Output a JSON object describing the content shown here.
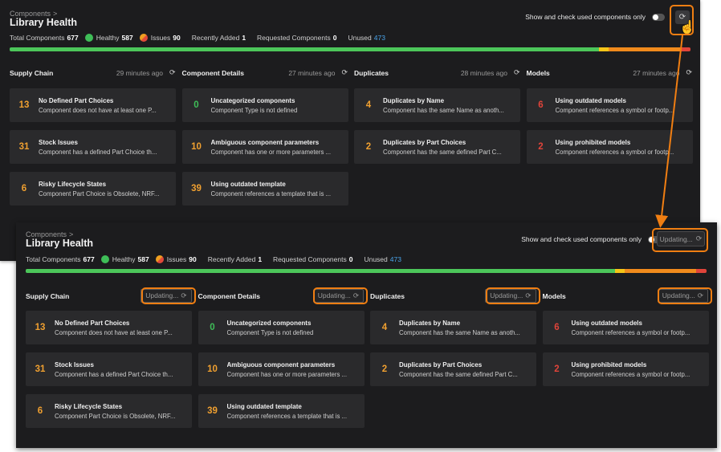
{
  "breadcrumb": "Components",
  "breadcrumb_chevron": ">",
  "page_title": "Library Health",
  "toggle_label": "Show and check used components only",
  "refresh_glyph": "⟳",
  "updating_label": "Updating...",
  "stats": {
    "total_label": "Total Components",
    "total": "677",
    "healthy_label": "Healthy",
    "healthy": "587",
    "issues_label": "Issues",
    "issues": "90",
    "recent_label": "Recently Added",
    "recent": "1",
    "requested_label": "Requested Components",
    "requested": "0",
    "unused_label": "Unused",
    "unused": "473"
  },
  "health_bar": {
    "healthy_pct": 86.6,
    "yellow_pct": 1.4,
    "orange_pct": 10.5,
    "red_pct": 1.5
  },
  "sections": [
    {
      "name": "Supply Chain",
      "time": "29 minutes ago",
      "cards": [
        {
          "count": "13",
          "title": "No Defined Part Choices",
          "desc": "Component does not have at least one P...",
          "color": "orange"
        },
        {
          "count": "31",
          "title": "Stock Issues",
          "desc": "Component has a defined Part Choice th...",
          "color": "orange"
        },
        {
          "count": "6",
          "title": "Risky Lifecycle States",
          "desc": "Component Part Choice is Obsolete, NRF...",
          "color": "orange"
        }
      ]
    },
    {
      "name": "Component Details",
      "time": "27 minutes ago",
      "cards": [
        {
          "count": "0",
          "title": "Uncategorized components",
          "desc": "Component Type is not defined",
          "color": "green"
        },
        {
          "count": "10",
          "title": "Ambiguous component parameters",
          "desc": "Component has one or more parameters ...",
          "color": "orange"
        },
        {
          "count": "39",
          "title": "Using outdated template",
          "desc": "Component references a template that is ...",
          "color": "orange"
        }
      ]
    },
    {
      "name": "Duplicates",
      "time": "28 minutes ago",
      "cards": [
        {
          "count": "4",
          "title": "Duplicates by Name",
          "desc": "Component has the same Name as anoth...",
          "color": "orange"
        },
        {
          "count": "2",
          "title": "Duplicates by Part Choices",
          "desc": "Component has the same defined Part C...",
          "color": "orange"
        }
      ]
    },
    {
      "name": "Models",
      "time": "27 minutes ago",
      "cards": [
        {
          "count": "6",
          "title": "Using outdated models",
          "desc": "Component references a symbol or footp...",
          "color": "red"
        },
        {
          "count": "2",
          "title": "Using prohibited models",
          "desc": "Component references a symbol or footp...",
          "color": "red"
        }
      ]
    }
  ],
  "colors": {
    "accent_orange": "#f07e12",
    "healthy_green": "#3fbe58",
    "issue_red": "#e0443a",
    "unused_blue": "#4aa3e8"
  }
}
